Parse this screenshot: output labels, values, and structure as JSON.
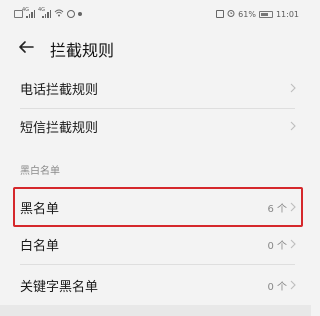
{
  "status_bar": {
    "left_icons": [
      "notification-icon",
      "signal-4g-icon",
      "signal-4g-icon",
      "wifi-icon",
      "settings-icon"
    ],
    "signal_tag": "4G",
    "battery": "61%",
    "time": "11:01",
    "right_icons": [
      "nfc-icon",
      "alarm-icon",
      "battery-icon"
    ]
  },
  "header": {
    "title": "拦截规则"
  },
  "rows_top": [
    {
      "label": "电话拦截规则"
    },
    {
      "label": "短信拦截规则"
    }
  ],
  "section": {
    "label": "黑白名单"
  },
  "rows_list": [
    {
      "label": "黑名单",
      "value": "6 个"
    },
    {
      "label": "白名单",
      "value": "0 个"
    },
    {
      "label": "关键字黑名单",
      "value": "0 个"
    }
  ],
  "colors": {
    "highlight": "#d5282b",
    "background": "#f3f3f3",
    "muted": "#888888"
  }
}
